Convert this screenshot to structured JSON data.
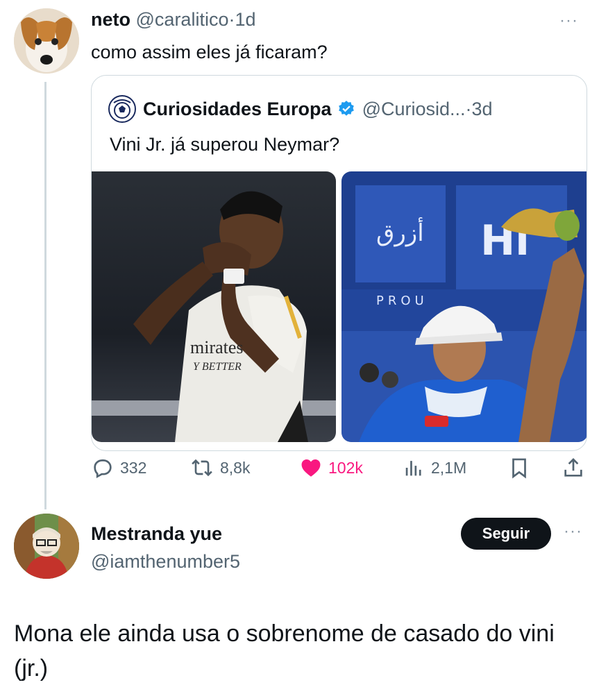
{
  "tweet1": {
    "display_name": "neto",
    "handle": "@caralitico",
    "separator": "·",
    "time": "1d",
    "more_label": "···",
    "text": "como assim eles já ficaram?"
  },
  "quoted": {
    "display_name": "Curiosidades Europa",
    "handle": "@Curiosid...",
    "separator": "·",
    "time": "3d",
    "text": "Vini Jr. já superou Neymar?",
    "images": [
      {
        "alt": "Vini Jr. blowing a kiss in white Real Madrid kit",
        "jersey_text": "mirates",
        "jersey_subtext": "Y BETTER"
      },
      {
        "alt": "Neymar in white cap and blue Al Hilal kit holding trophy",
        "banner_text": "PROU"
      }
    ]
  },
  "actions": {
    "replies": "332",
    "retweets": "8,8k",
    "likes": "102k",
    "views": "2,1M"
  },
  "tweet2": {
    "display_name": "Mestranda yue",
    "handle": "@iamthenumber5",
    "follow_label": "Seguir",
    "more_label": "···",
    "text": "Mona ele ainda usa o sobrenome de casado do vini (jr.)"
  },
  "colors": {
    "like": "#f91880",
    "muted": "#536471",
    "verified": "#1d9bf0",
    "follow_bg": "#0f1419"
  },
  "icons": [
    "reply-icon",
    "retweet-icon",
    "heart-icon",
    "views-icon",
    "bookmark-icon",
    "share-icon",
    "verified-badge-icon",
    "more-icon"
  ]
}
